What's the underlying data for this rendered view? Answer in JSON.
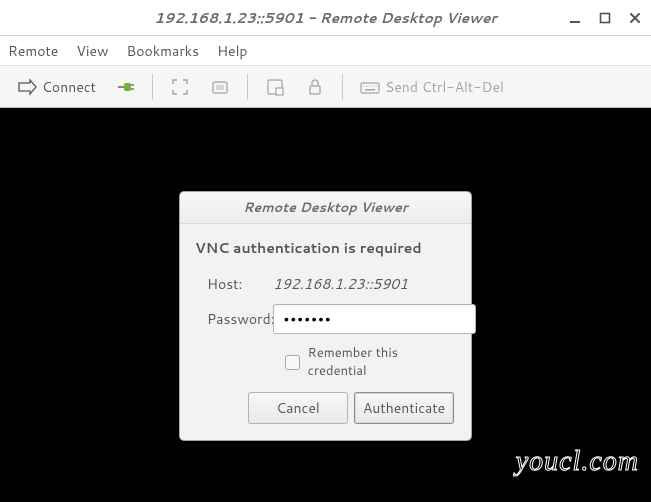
{
  "titlebar": {
    "title": "192.168.1.23::5901 - Remote Desktop Viewer"
  },
  "menubar": {
    "items": [
      "Remote",
      "View",
      "Bookmarks",
      "Help"
    ]
  },
  "toolbar": {
    "connect_label": "Connect",
    "send_ctrl_alt_del_label": "Send Ctrl-Alt-Del"
  },
  "dialog": {
    "title": "Remote Desktop Viewer",
    "heading": "VNC authentication is required",
    "host_label": "Host:",
    "host_value": "192.168.1.23::5901",
    "password_label": "Password:",
    "password_value": "•••••••",
    "remember_label": "Remember this credential",
    "cancel_label": "Cancel",
    "authenticate_label": "Authenticate"
  },
  "watermark": "youcl.com"
}
